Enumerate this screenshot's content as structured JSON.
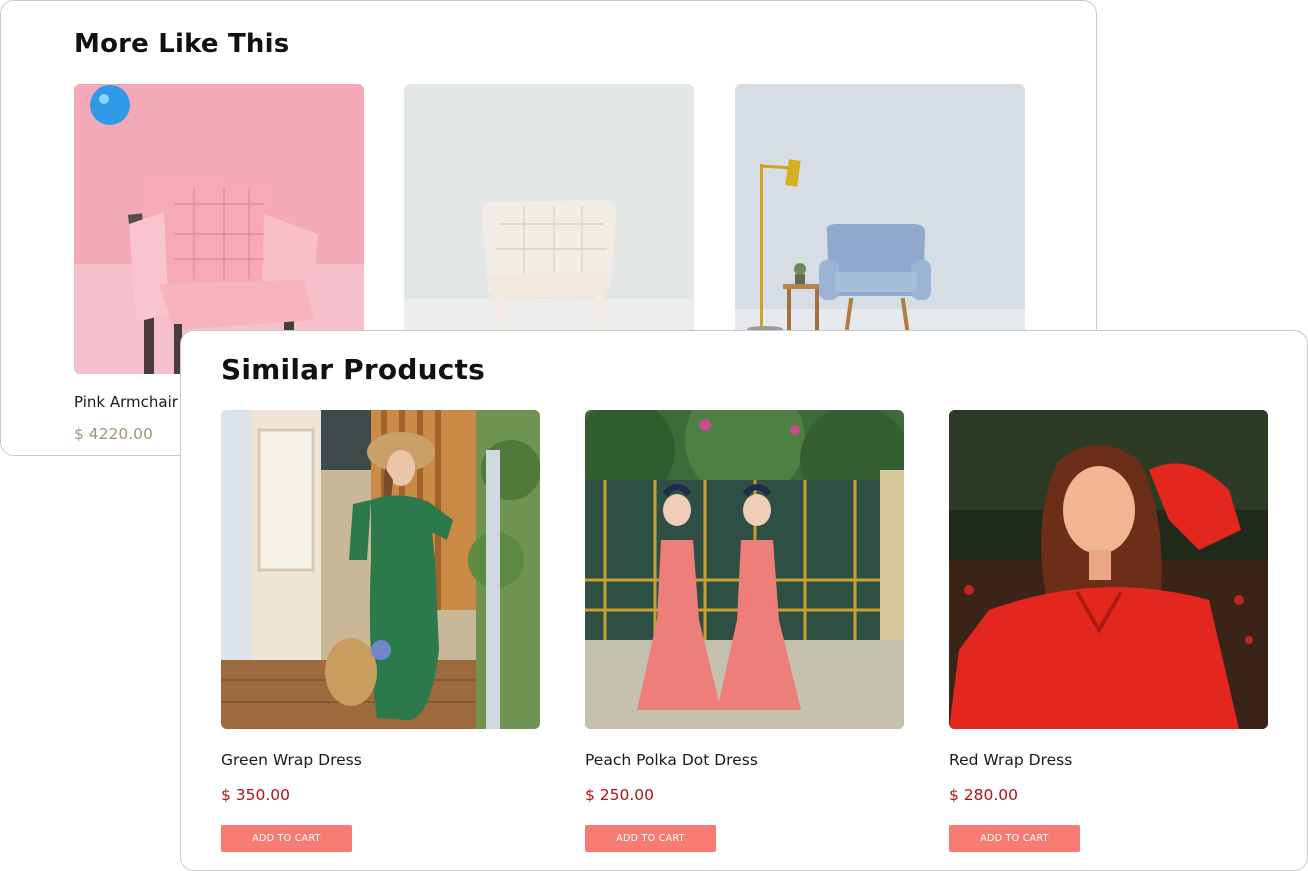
{
  "more_like_this": {
    "title": "More Like This",
    "items": [
      {
        "name": "Pink Armchair",
        "price": "$ 4220.00",
        "image": "pink-armchair-photo"
      },
      {
        "name": "",
        "price": "",
        "image": "white-tufted-chair-photo"
      },
      {
        "name": "",
        "price": "",
        "image": "blue-armchair-with-lamp-photo"
      }
    ]
  },
  "similar_products": {
    "title": "Similar Products",
    "items": [
      {
        "name": "Green Wrap Dress",
        "price": "$ 350.00",
        "button": "ADD TO CART",
        "image": "green-dress-model-photo"
      },
      {
        "name": "Peach Polka Dot Dress",
        "price": "$ 250.00",
        "button": "ADD TO CART",
        "image": "peach-dress-models-photo"
      },
      {
        "name": "Red Wrap Dress",
        "price": "$ 280.00",
        "button": "ADD TO CART",
        "image": "red-dress-model-photo"
      }
    ]
  },
  "colors": {
    "button_bg": "#f57b73",
    "price_red": "#b01218",
    "price_muted": "#a39575",
    "card_border": "#c9c9c9"
  }
}
